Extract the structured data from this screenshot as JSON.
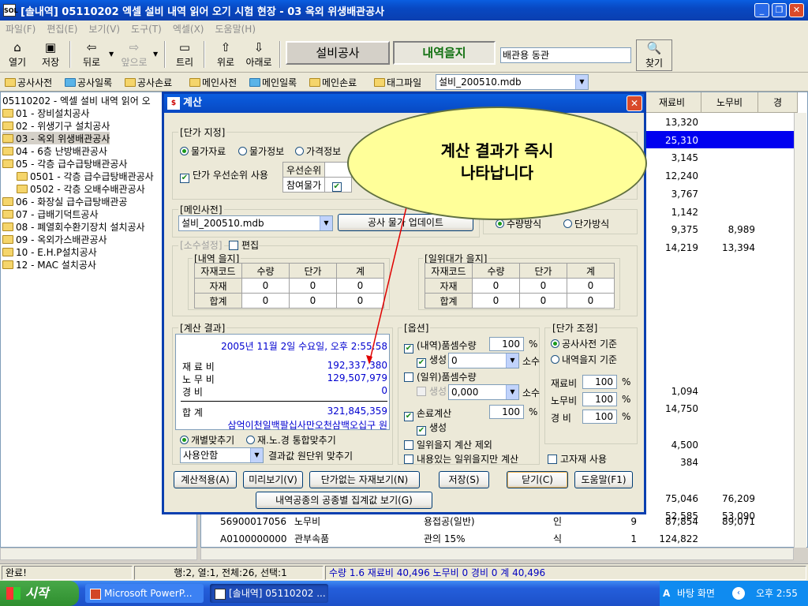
{
  "window": {
    "title": "[솔내역] 05110202 엑셀 설비 내역 읽어 오기 시험 현장 - 03 옥외 위생배관공사",
    "logo": "SOL"
  },
  "menu": [
    "파일(F)",
    "편집(E)",
    "보기(V)",
    "도구(T)",
    "엑셀(X)",
    "도움말(H)"
  ],
  "toolbar": {
    "open": "열기",
    "save": "저장",
    "back": "뒤로",
    "forward": "앞으로",
    "tree": "트리",
    "up": "위로",
    "down": "아래로",
    "tab1": "설비공사",
    "tab2": "내역을지",
    "search_value": "배관용 동관",
    "find": "찾기"
  },
  "subbar": {
    "items": [
      "공사사전",
      "공사일록",
      "공사손료",
      "메인사전",
      "메인일록",
      "메인손료",
      "태그파일"
    ],
    "db_combo": "설비_200510.mdb"
  },
  "tree": {
    "root": "05110202 - 엑셀 설비 내역 읽어 오",
    "items": [
      "01 - 장비설치공사",
      "02 - 위생기구 설치공사",
      "03 - 옥외 위생배관공사",
      "04 - 6층 난방배관공사",
      "05 - 각층 급수급탕배관공사",
      "0501 - 각층 급수급탕배관공사",
      "0502 - 각층 오배수배관공사",
      "06 - 화장실 급수급탕배관공",
      "07 - 급배기덕트공사",
      "08 - 폐열회수환기장치 설치공사",
      "09 - 옥외가스배관공사",
      "10 - E.H.P설치공사",
      "12 - MAC 설치공사"
    ]
  },
  "grid": {
    "headers": [
      "재료비",
      "노무비",
      "경"
    ],
    "rows": [
      [
        "13,320",
        ""
      ],
      [
        "25,310",
        ""
      ],
      [
        "3,145",
        ""
      ],
      [
        "12,240",
        ""
      ],
      [
        "3,767",
        ""
      ],
      [
        "1,142",
        ""
      ],
      [
        "9,375",
        "8,989"
      ],
      [
        "14,219",
        "13,394"
      ],
      [
        "",
        ""
      ],
      [
        "",
        ""
      ],
      [
        "",
        ""
      ],
      [
        "",
        ""
      ],
      [
        "",
        ""
      ],
      [
        "",
        ""
      ],
      [
        "",
        ""
      ],
      [
        "1,094",
        ""
      ],
      [
        "14,750",
        ""
      ],
      [
        "",
        ""
      ],
      [
        "4,500",
        ""
      ],
      [
        "384",
        ""
      ],
      [
        "",
        ""
      ],
      [
        "75,046",
        "76,209"
      ],
      [
        "52,585",
        "53,090"
      ]
    ],
    "bottom_rows": [
      {
        "code": "56900017056",
        "name": "노무비",
        "spec": "용접공(일반)",
        "unit": "인",
        "qty": "9",
        "mat": "87,854",
        "lab": "89,071"
      },
      {
        "code": "A0100000000",
        "name": "관부속품",
        "spec": "관의 15%",
        "unit": "식",
        "qty": "1",
        "mat": "124,822",
        "lab": ""
      }
    ]
  },
  "status": {
    "left": "완료!",
    "pos": "행:2, 열:1, 전체:26, 선택:1",
    "summary": "수량 1.6  재료비 40,496  노무비 0  경비 0  계 40,496"
  },
  "taskbar": {
    "start": "시작",
    "task1": "Microsoft PowerP...",
    "task2": "[솔내역] 05110202 ...",
    "tray_text": "바탕 화면",
    "clock": "오후 2:55"
  },
  "dialog": {
    "title": "계산",
    "price_group": "단가 지정",
    "price_radios": [
      "물가자료",
      "물가정보",
      "가격정보"
    ],
    "priority_check": "단가 우선순위 사용",
    "priority_table": {
      "h": "우선순위",
      "v": "참여물가"
    },
    "main_group": "메인사전",
    "main_combo": "설비_200510.mdb",
    "update_btn": "공사 물가 업데이트",
    "method_radios": [
      "수량방식",
      "단가방식"
    ],
    "decimal_group": "소수설정",
    "edit_check": "편집",
    "left_tbl_group": "내역 을지",
    "right_tbl_group": "일위대가 을지",
    "tbl_headers": [
      "자재코드",
      "수량",
      "단가",
      "계"
    ],
    "tbl_rows": [
      [
        "자재",
        "0",
        "0",
        "0"
      ],
      [
        "합계",
        "0",
        "0",
        "0"
      ]
    ],
    "result_group": "계산 결과",
    "result_date": "2005년 11월 2일 수요일, 오후 2:55:58",
    "result_labels": [
      "재 료 비",
      "노 무 비",
      "경    비",
      "합    계"
    ],
    "result_values": [
      "192,337,380",
      "129,507,979",
      "0",
      "321,845,359"
    ],
    "result_words": "삼억이천일백팔십사만오천삼백오십구 원",
    "round_radios": [
      "개별맞추기",
      "재.노.경 통합맞추기"
    ],
    "round_combo": "사용안함",
    "round_label": "결과값 원단위 맞추기",
    "option_group": "옵션",
    "opt1": "(내역)품셈수량",
    "opt1_val": "100",
    "opt1_pct": "%",
    "opt1_sub": "생성",
    "opt1_combo": "0",
    "opt1_unit": "소수",
    "opt2": "(일위)품셈수량",
    "opt2_sub": "생성",
    "opt2_combo": "0,000",
    "opt2_unit": "소수",
    "opt3": "손료계산",
    "opt3_val": "100",
    "opt3_pct": "%",
    "opt3_sub": "생성",
    "opt4": "일위을지 계산 제외",
    "opt5": "내용있는 일위을지만 계산",
    "adjust_group": "단가 조정",
    "adjust_radios": [
      "공사사전 기준",
      "내역을지 기준"
    ],
    "adjust_labels": [
      "재료비",
      "노무비",
      "경   비"
    ],
    "adjust_vals": [
      "100",
      "100",
      "100"
    ],
    "pct": "%",
    "scrap_check": "고자재 사용",
    "buttons": [
      "계산적용(A)",
      "미리보기(V)",
      "단가없는 자재보기(N)",
      "저장(S)",
      "닫기(C)",
      "도움말(F1)"
    ],
    "bottom_btn": "내역공종의 공종별 집계값 보기(G)"
  },
  "callout": {
    "line1": "계산 결과가 즉시",
    "line2": "나타납니다"
  }
}
